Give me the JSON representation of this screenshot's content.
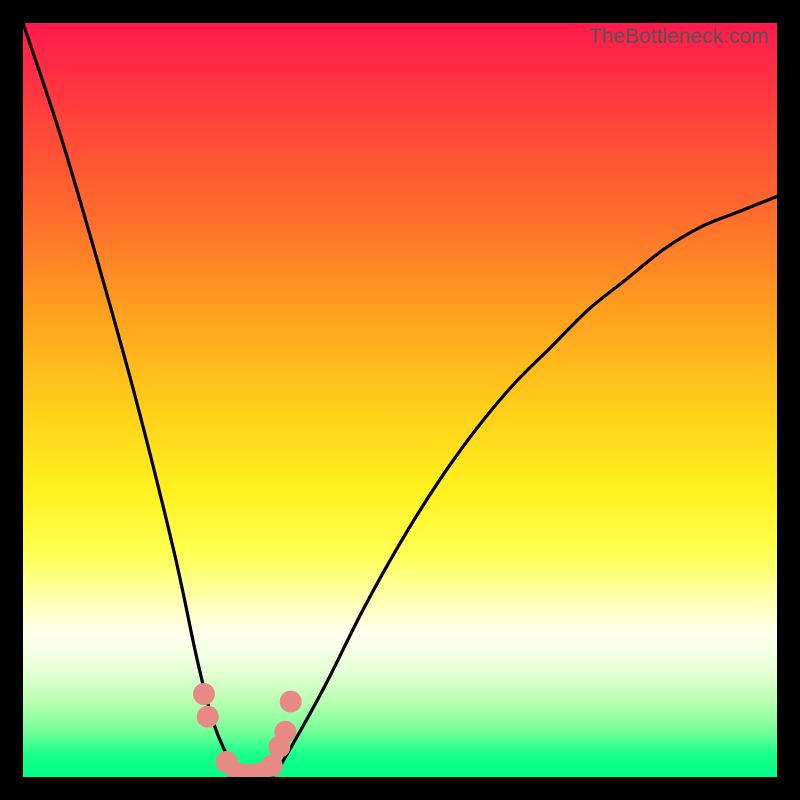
{
  "watermark": "TheBottleneck.com",
  "chart_data": {
    "type": "line",
    "title": "",
    "xlabel": "",
    "ylabel": "",
    "xlim": [
      0,
      100
    ],
    "ylim": [
      0,
      100
    ],
    "series": [
      {
        "name": "bottleneck-curve",
        "x": [
          0,
          5,
          10,
          15,
          20,
          23,
          25,
          27,
          29,
          31,
          33,
          35,
          40,
          45,
          50,
          55,
          60,
          65,
          70,
          75,
          80,
          85,
          90,
          95,
          100
        ],
        "values": [
          100,
          85,
          68,
          50,
          30,
          16,
          8,
          3,
          0,
          0,
          0,
          3,
          12,
          22,
          31,
          39,
          46,
          52,
          57,
          62,
          66,
          70,
          73,
          75,
          77
        ]
      }
    ],
    "markers": {
      "name": "highlighted-points",
      "color": "#e78a85",
      "points": [
        {
          "x": 24.0,
          "y": 11
        },
        {
          "x": 24.5,
          "y": 8
        },
        {
          "x": 27.0,
          "y": 2
        },
        {
          "x": 28.5,
          "y": 0.5
        },
        {
          "x": 30.0,
          "y": 0.3
        },
        {
          "x": 31.5,
          "y": 0.5
        },
        {
          "x": 33.0,
          "y": 1.5
        },
        {
          "x": 34.0,
          "y": 4
        },
        {
          "x": 34.8,
          "y": 6
        },
        {
          "x": 35.5,
          "y": 10
        }
      ]
    }
  }
}
